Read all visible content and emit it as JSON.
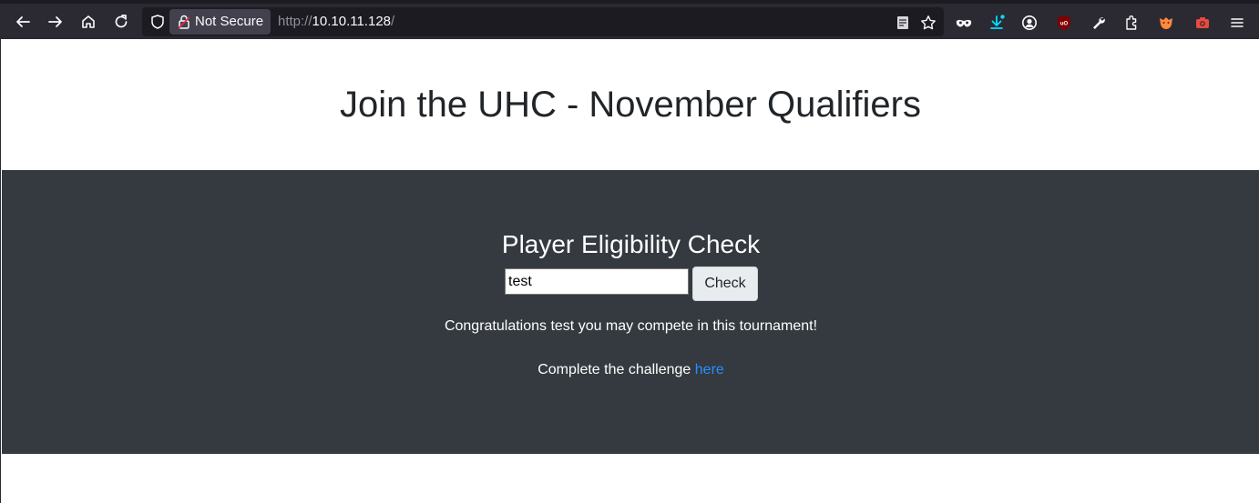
{
  "browser": {
    "security_label": "Not Secure",
    "url_protocol": "http://",
    "url_host": "10.10.11.128",
    "url_trailing": "/"
  },
  "page": {
    "title": "Join the UHC - November Qualifiers",
    "form_heading": "Player Eligibility Check",
    "input_value": "test",
    "check_button": "Check",
    "result_message": "Congratulations test you may compete in this tournament!",
    "challenge_text": "Complete the challenge",
    "challenge_link": "here"
  },
  "colors": {
    "toolbar_bg": "#2b2a33",
    "band_bg": "#343a40",
    "link": "#2b8cff"
  },
  "icons": [
    "back-icon",
    "forward-icon",
    "home-icon",
    "reload-icon",
    "shield-icon",
    "lock-icon",
    "reader-view-icon",
    "bookmark-star-icon",
    "incognito-mask-icon",
    "downloads-icon",
    "account-icon",
    "ublock-icon",
    "wrench-icon",
    "extensions-icon",
    "foxy-extension-icon",
    "screenshot-icon",
    "menu-icon"
  ]
}
